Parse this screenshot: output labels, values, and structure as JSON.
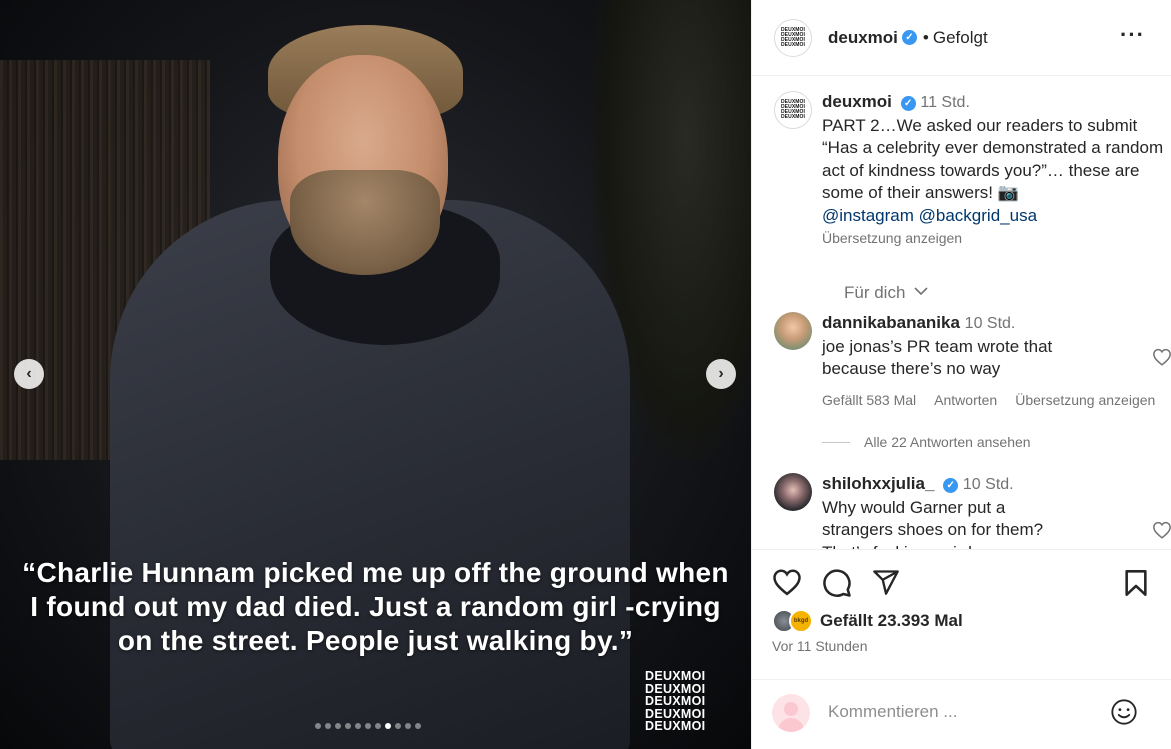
{
  "media": {
    "quote": "“Charlie Hunnam picked me up off the ground when I found out my dad died. Just a random girl -crying on the street. People just walking by.”",
    "brand_lines": [
      "DEUXMOI",
      "DEUXMOI",
      "DEUXMOI",
      "DEUXMOI",
      "DEUXMOI"
    ],
    "prev_arrow": "‹",
    "next_arrow": "›",
    "slide_count": 11,
    "active_slide": 8
  },
  "header": {
    "avatar_text": [
      "DEUXMOI",
      "DEUXMOI",
      "DEUXMOI",
      "DEUXMOI"
    ],
    "username": "deuxmoi",
    "verified_mark": "✓",
    "separator": "•",
    "follow_state": "Gefolgt",
    "more": "···"
  },
  "caption": {
    "username": "deuxmoi",
    "time": "11 Std.",
    "text": "PART 2…We asked our readers to submit “Has a celebrity ever demonstrated a random act of kindness towards you?”… these are some of their answers! 📷",
    "mention_1": "@instagram",
    "mention_2": "@backgrid_usa",
    "translate": "Übersetzung anzeigen",
    "for_you": "Für dich"
  },
  "comments": [
    {
      "username": "dannikabananika",
      "time": "10 Std.",
      "text": "joe jonas’s PR team wrote that because there’s no way",
      "likes": "Gefällt 583 Mal",
      "reply": "Antworten",
      "translate": "Übersetzung anzeigen",
      "view_replies": "Alle 22 Antworten ansehen"
    },
    {
      "username": "shilohxxjulia_",
      "time": "10 Std.",
      "text": "Why would Garner put a strangers shoes on for them? That’s fucking weird."
    }
  ],
  "actions": {
    "liked_by_badge": "bkgd",
    "likes": "Gefällt 23.393 Mal",
    "ago": "Vor 11 Stunden"
  },
  "composer": {
    "placeholder": "Kommentieren ..."
  },
  "colors": {
    "verified": "#3897f0",
    "muted": "#737373",
    "mention": "#00376b"
  }
}
